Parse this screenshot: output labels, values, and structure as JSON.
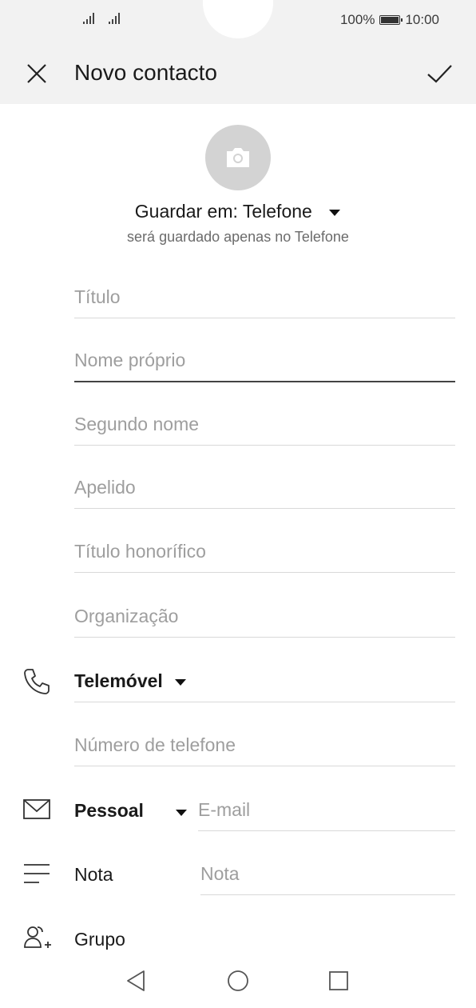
{
  "status_bar": {
    "battery_percent": "100%",
    "time": "10:00"
  },
  "toolbar": {
    "title": "Novo contacto",
    "close_icon": "close-icon",
    "save_icon": "check-icon"
  },
  "avatar": {
    "icon": "camera-icon"
  },
  "save_location": {
    "label": "Guardar em: Telefone",
    "subtitle": "será guardado apenas no Telefone"
  },
  "fields": {
    "title": "Título",
    "first_name": "Nome próprio",
    "middle_name": "Segundo nome",
    "last_name": "Apelido",
    "honorific": "Título honorífico",
    "organization": "Organização"
  },
  "phone": {
    "type_label": "Telemóvel",
    "number_placeholder": "Número de telefone"
  },
  "email": {
    "type_label": "Pessoal",
    "placeholder": "E-mail"
  },
  "note": {
    "label": "Nota",
    "placeholder": "Nota"
  },
  "group": {
    "label": "Grupo"
  },
  "colors": {
    "header_bg": "#f2f2f2",
    "placeholder": "#9e9e9e",
    "divider": "#d9d9d9",
    "avatar_bg": "#d3d3d3"
  }
}
